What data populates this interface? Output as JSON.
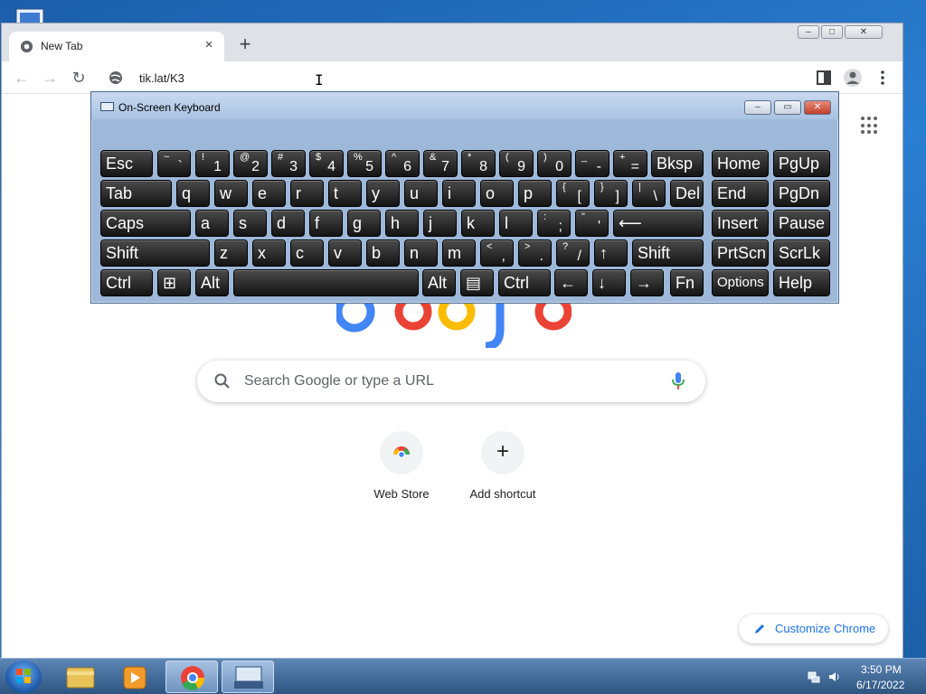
{
  "browser": {
    "tab_title": "New Tab",
    "tab_close": "×",
    "new_tab": "+",
    "window_controls": [
      "–",
      "□",
      "✕"
    ],
    "address": "tik.lat/K3",
    "search_placeholder": "Search Google or type a URL",
    "shortcuts": [
      {
        "label": "Web Store",
        "icon": "chrome-web-store-icon"
      },
      {
        "label": "Add shortcut",
        "icon": "plus-icon",
        "glyph": "+"
      }
    ],
    "customize_label": "Customize Chrome"
  },
  "osk": {
    "title": "On-Screen Keyboard",
    "rows": [
      [
        {
          "main": "Esc"
        },
        {
          "shift": "~",
          "low": "`"
        },
        {
          "shift": "!",
          "low": "1"
        },
        {
          "shift": "@",
          "low": "2"
        },
        {
          "shift": "#",
          "low": "3"
        },
        {
          "shift": "$",
          "low": "4"
        },
        {
          "shift": "%",
          "low": "5"
        },
        {
          "shift": "^",
          "low": "6"
        },
        {
          "shift": "&",
          "low": "7"
        },
        {
          "shift": "*",
          "low": "8"
        },
        {
          "shift": "(",
          "low": "9"
        },
        {
          "shift": ")",
          "low": "0"
        },
        {
          "shift": "_",
          "low": "-"
        },
        {
          "shift": "+",
          "low": "="
        },
        {
          "main": "Bksp"
        },
        {
          "main": "Home"
        },
        {
          "main": "PgUp"
        }
      ],
      [
        {
          "main": "Tab"
        },
        {
          "main": "q"
        },
        {
          "main": "w"
        },
        {
          "main": "e"
        },
        {
          "main": "r"
        },
        {
          "main": "t"
        },
        {
          "main": "y"
        },
        {
          "main": "u"
        },
        {
          "main": "i"
        },
        {
          "main": "o"
        },
        {
          "main": "p"
        },
        {
          "shift": "{",
          "low": "["
        },
        {
          "shift": "}",
          "low": "]"
        },
        {
          "shift": "|",
          "low": "\\"
        },
        {
          "main": "Del"
        },
        {
          "main": "End"
        },
        {
          "main": "PgDn"
        }
      ],
      [
        {
          "main": "Caps"
        },
        {
          "main": "a"
        },
        {
          "main": "s"
        },
        {
          "main": "d"
        },
        {
          "main": "f"
        },
        {
          "main": "g"
        },
        {
          "main": "h"
        },
        {
          "main": "j"
        },
        {
          "main": "k"
        },
        {
          "main": "l"
        },
        {
          "shift": ":",
          "low": ";"
        },
        {
          "shift": "\"",
          "low": "'"
        },
        {
          "main": "⟵"
        },
        {
          "main": "Insert"
        },
        {
          "main": "Pause"
        }
      ],
      [
        {
          "main": "Shift"
        },
        {
          "main": "z"
        },
        {
          "main": "x"
        },
        {
          "main": "c"
        },
        {
          "main": "v"
        },
        {
          "main": "b"
        },
        {
          "main": "n"
        },
        {
          "main": "m"
        },
        {
          "shift": "<",
          "low": ","
        },
        {
          "shift": ">",
          "low": "."
        },
        {
          "shift": "?",
          "low": "/"
        },
        {
          "main": "↑"
        },
        {
          "main": "Shift"
        },
        {
          "main": "PrtScn"
        },
        {
          "main": "ScrLk"
        }
      ],
      [
        {
          "main": "Ctrl"
        },
        {
          "main": "⊞"
        },
        {
          "main": "Alt"
        },
        {
          "main": ""
        },
        {
          "main": "Alt"
        },
        {
          "main": "▤"
        },
        {
          "main": "Ctrl"
        },
        {
          "main": "←"
        },
        {
          "main": "↓"
        },
        {
          "main": "→"
        },
        {
          "main": "Fn"
        },
        {
          "main": "Options"
        },
        {
          "main": "Help"
        }
      ]
    ]
  },
  "taskbar": {
    "time": "3:50 PM",
    "date": "6/17/2022",
    "apps": [
      "windows-explorer-icon",
      "media-player-icon",
      "chrome-icon",
      "on-screen-keyboard-icon"
    ]
  },
  "colors": {
    "accent": "#1a73e8",
    "taskbar": "#2d5580"
  }
}
